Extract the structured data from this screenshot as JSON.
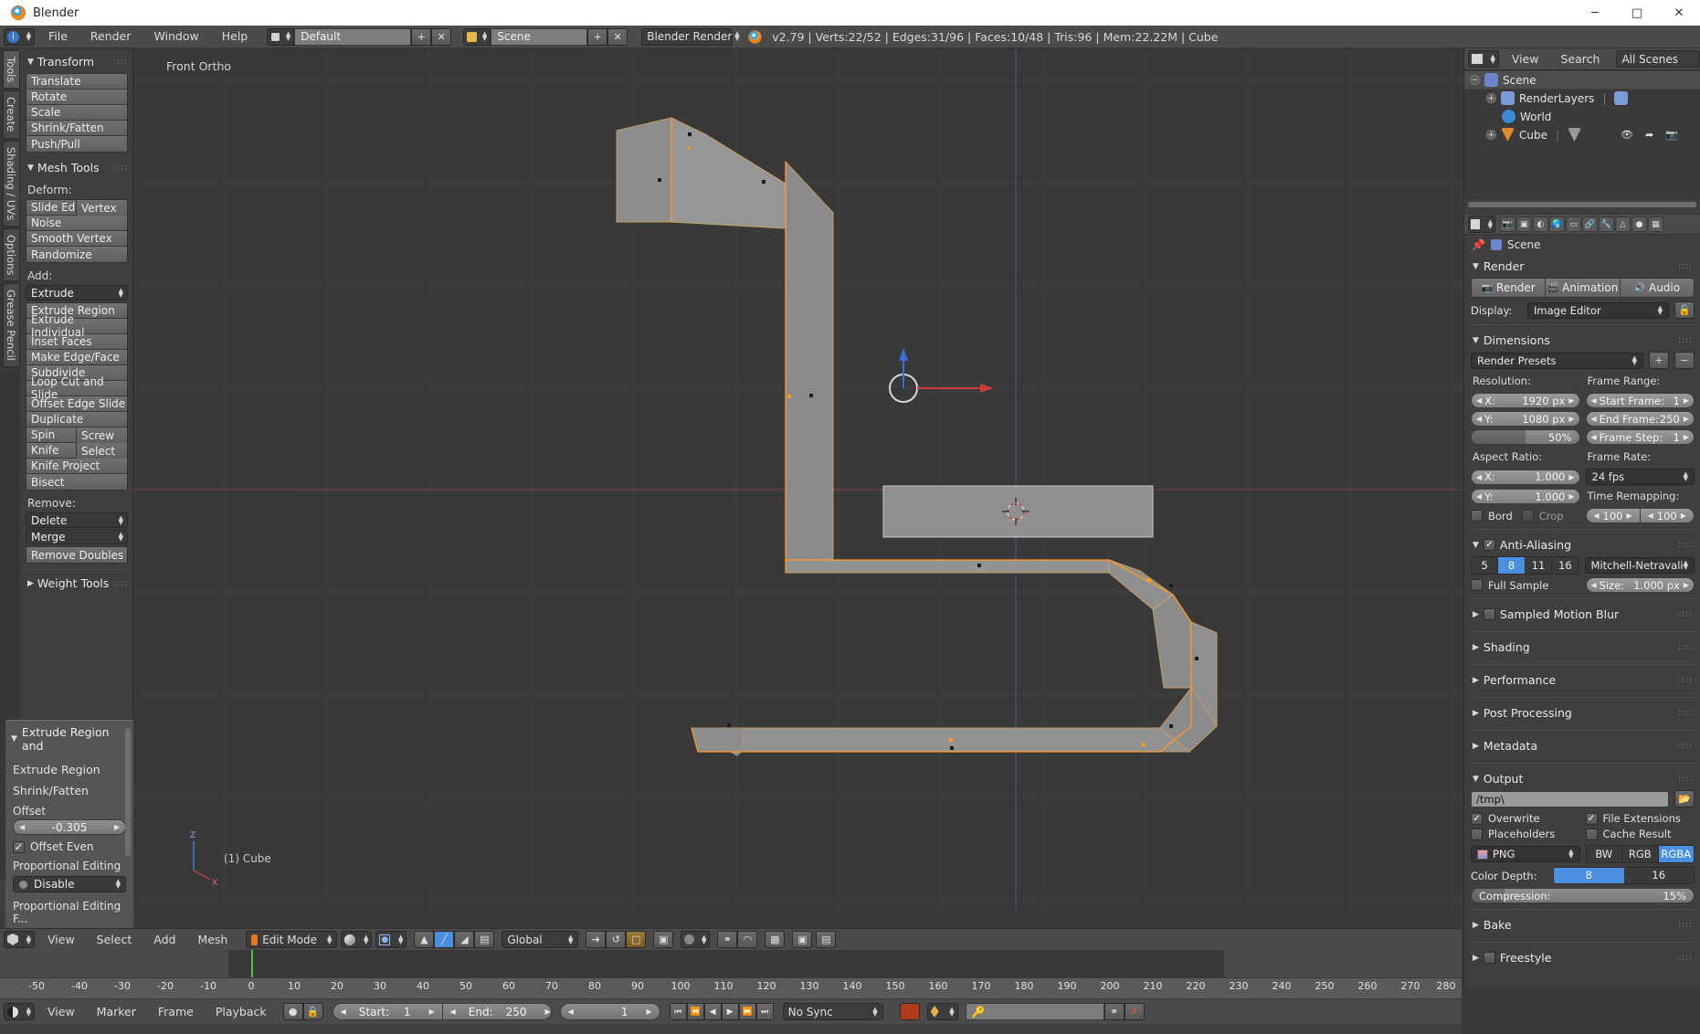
{
  "window": {
    "title": "Blender",
    "minimize": "─",
    "maximize": "□",
    "close": "✕"
  },
  "info_header": {
    "menus": [
      "File",
      "Render",
      "Window",
      "Help"
    ],
    "screen_layout": "Default",
    "scene_name": "Scene",
    "engine": "Blender Render",
    "stats": "v2.79 | Verts:22/52 | Edges:31/96 | Faces:10/48 | Tris:96 | Mem:22.22M | Cube",
    "add_icon": "+",
    "remove_icon": "✕"
  },
  "toolshelf": {
    "tabs": [
      "Tools",
      "Create",
      "Shading / UVs",
      "Options",
      "Grease Pencil"
    ],
    "active_tab": "Tools",
    "transform": {
      "title": "Transform",
      "buttons": [
        "Translate",
        "Rotate",
        "Scale",
        "Shrink/Fatten",
        "Push/Pull"
      ]
    },
    "mesh_tools": {
      "title": "Mesh Tools",
      "deform_label": "Deform:",
      "deform_row": [
        "Slide Ed",
        "Vertex"
      ],
      "deform_buttons": [
        "Noise",
        "Smooth Vertex",
        "Randomize"
      ],
      "add_label": "Add:",
      "add_dropdown": "Extrude",
      "add_buttons": [
        "Extrude Region",
        "Extrude Individual",
        "Inset Faces",
        "Make Edge/Face",
        "Subdivide",
        "Loop Cut and Slide",
        "Offset Edge Slide",
        "Duplicate"
      ],
      "add_row_1": [
        "Spin",
        "Screw"
      ],
      "add_row_2": [
        "Knife",
        "Select"
      ],
      "add_buttons_2": [
        "Knife Project",
        "Bisect"
      ],
      "remove_label": "Remove:",
      "remove_dropdowns": [
        "Delete",
        "Merge"
      ],
      "remove_buttons": [
        "Remove Doubles"
      ]
    },
    "weight_tools": {
      "title": "Weight Tools"
    }
  },
  "operator_panel": {
    "title": "Extrude Region and",
    "lines": [
      "Extrude Region",
      "Shrink/Fatten"
    ],
    "offset_label": "Offset",
    "offset_value": "-0.305",
    "offset_even_label": "Offset Even",
    "offset_even_checked": true,
    "prop_edit_label": "Proportional Editing",
    "prop_edit_value": "Disable",
    "prop_edit_falloff_label": "Proportional Editing F..."
  },
  "viewport": {
    "view_label": "Front Ortho",
    "object_label": "(1) Cube",
    "axis_x": "X",
    "axis_z": "Z"
  },
  "viewport_header": {
    "menus": [
      "View",
      "Select",
      "Add",
      "Mesh"
    ],
    "mode": "Edit Mode",
    "transform_orientation": "Global",
    "mode_icon": "mode-icon",
    "shading_icon": "shading-sphere-icon",
    "pivot_icon": "pivot-icon",
    "select_vertex_icon": "vertex-select-icon",
    "select_edge_icon": "edge-select-icon",
    "select_face_icon": "face-select-icon"
  },
  "timeline": {
    "menus": [
      "View",
      "Marker",
      "Frame",
      "Playback"
    ],
    "start_label": "Start:",
    "start_value": "1",
    "end_label": "End:",
    "end_value": "250",
    "current_frame": "1",
    "sync_mode": "No Sync",
    "ticks": [
      "-50",
      "-40",
      "-30",
      "-20",
      "-10",
      "0",
      "10",
      "20",
      "30",
      "40",
      "50",
      "60",
      "70",
      "80",
      "90",
      "100",
      "110",
      "120",
      "130",
      "140",
      "150",
      "160",
      "170",
      "180",
      "190",
      "200",
      "210",
      "220",
      "230",
      "240",
      "250",
      "260",
      "270",
      "280"
    ]
  },
  "outliner": {
    "menus": [
      "View",
      "Search"
    ],
    "filter": "All Scenes",
    "rows": [
      {
        "label": "Scene",
        "icon": "scene-icon",
        "depth": 0,
        "selected": true
      },
      {
        "label": "RenderLayers",
        "icon": "renderlayers-icon",
        "depth": 1,
        "selected": false
      },
      {
        "label": "World",
        "icon": "world-icon",
        "depth": 1,
        "selected": false
      },
      {
        "label": "Cube",
        "icon": "mesh-object-icon",
        "depth": 1,
        "selected": false
      }
    ]
  },
  "properties": {
    "breadcrumb": "Scene",
    "render": {
      "title": "Render",
      "buttons": [
        "Render",
        "Animation",
        "Audio"
      ],
      "display_label": "Display:",
      "display_value": "Image Editor"
    },
    "dimensions": {
      "title": "Dimensions",
      "presets": "Render Presets",
      "resolution_label": "Resolution:",
      "res_x_label": "X:",
      "res_x_value": "1920 px",
      "res_y_label": "Y:",
      "res_y_value": "1080 px",
      "res_percent": "50%",
      "frame_range_label": "Frame Range:",
      "start_frame_label": "Start Frame:",
      "start_frame_value": "1",
      "end_frame_label": "End Frame:",
      "end_frame_value": "250",
      "frame_step_label": "Frame Step:",
      "frame_step_value": "1",
      "aspect_label": "Aspect Ratio:",
      "aspect_x_label": "X:",
      "aspect_x_value": "1.000",
      "aspect_y_label": "Y:",
      "aspect_y_value": "1.000",
      "border_label": "Bord",
      "crop_label": "Crop",
      "frame_rate_label": "Frame Rate:",
      "frame_rate_value": "24 fps",
      "time_remap_label": "Time Remapping:",
      "time_remap_old": "100",
      "time_remap_new": "100"
    },
    "antialiasing": {
      "title": "Anti-Aliasing",
      "enabled": true,
      "samples": [
        "5",
        "8",
        "11",
        "16"
      ],
      "active_sample": "8",
      "filter": "Mitchell-Netravali",
      "full_sample_label": "Full Sample",
      "size_label": "Size:",
      "size_value": "1.000 px"
    },
    "collapsed": [
      "Sampled Motion Blur",
      "Shading",
      "Performance",
      "Post Processing",
      "Metadata"
    ],
    "output": {
      "title": "Output",
      "path": "/tmp\\",
      "overwrite_label": "Overwrite",
      "overwrite_checked": true,
      "file_ext_label": "File Extensions",
      "file_ext_checked": true,
      "placeholders_label": "Placeholders",
      "placeholders_checked": false,
      "cache_label": "Cache Result",
      "cache_checked": false,
      "format": "PNG",
      "channels": [
        "BW",
        "RGB",
        "RGBA"
      ],
      "active_channel": "RGBA",
      "color_depth_label": "Color Depth:",
      "color_depth_options": [
        "8",
        "16"
      ],
      "active_color_depth": "8",
      "compression_label": "Compression:",
      "compression_value": "15%"
    },
    "bottom_collapsed": [
      "Bake",
      "Freestyle"
    ]
  },
  "colors": {
    "accent_blue": "#4a8fe0",
    "edge_orange": "#ff9c22",
    "axis_z": "#3a70d8",
    "axis_x": "#d03a3a",
    "mesh_fill": "#8a8a8a"
  }
}
